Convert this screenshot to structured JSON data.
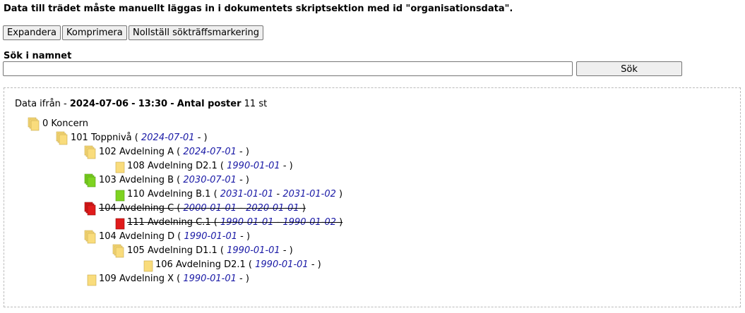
{
  "notice": "Data till trädet måste manuellt läggas in i dokumentets skriptsektion med id \"organisationsdata\".",
  "toolbar": {
    "expand_label": "Expandera",
    "collapse_label": "Komprimera",
    "reset_label": "Nollställ sökträffsmarkering"
  },
  "search": {
    "label": "Sök i namnet",
    "value": "",
    "button_label": "Sök"
  },
  "meta": {
    "prefix": "Data ifrån -",
    "date": "2024-07-06",
    "sep1": "-",
    "time": "13:30",
    "sep2": "-",
    "count_label": "Antal poster",
    "count": "11 st"
  },
  "colors": {
    "folder_yellow": "#f9dc7c",
    "folder_green": "#7ed321",
    "folder_red": "#e01b1b",
    "date_blue": "#1a1aa6"
  },
  "tree": [
    {
      "name": "0 Koncern",
      "from": "",
      "to": "",
      "icon": "folder-multi-icon",
      "color": "yellow",
      "depth": 0,
      "struck": false
    },
    {
      "name": "101 Toppnivå",
      "from": "2024-07-01",
      "to": "",
      "icon": "folder-multi-icon",
      "color": "yellow",
      "depth": 1,
      "struck": false
    },
    {
      "name": "102 Avdelning A",
      "from": "2024-07-01",
      "to": "",
      "icon": "folder-multi-icon",
      "color": "yellow",
      "depth": 2,
      "struck": false
    },
    {
      "name": "108 Avdelning D2.1",
      "from": "1990-01-01",
      "to": "",
      "icon": "folder-single-icon",
      "color": "yellow",
      "depth": 3,
      "struck": false
    },
    {
      "name": "103 Avdelning B",
      "from": "2030-07-01",
      "to": "",
      "icon": "folder-multi-icon",
      "color": "green",
      "depth": 2,
      "struck": false
    },
    {
      "name": "110 Avdelning B.1",
      "from": "2031-01-01",
      "to": "2031-01-02",
      "icon": "folder-single-icon",
      "color": "green",
      "depth": 3,
      "struck": false
    },
    {
      "name": "104 Avdelning C",
      "from": "2000-01-01",
      "to": "2020-01-01",
      "icon": "folder-multi-icon",
      "color": "red",
      "depth": 2,
      "struck": true
    },
    {
      "name": "111 Avdelning C.1",
      "from": "1990-01-01",
      "to": "1990-01-02",
      "icon": "folder-single-icon",
      "color": "red",
      "depth": 3,
      "struck": true
    },
    {
      "name": "104 Avdelning D",
      "from": "1990-01-01",
      "to": "",
      "icon": "folder-multi-icon",
      "color": "yellow",
      "depth": 2,
      "struck": false
    },
    {
      "name": "105 Avdelning D1.1",
      "from": "1990-01-01",
      "to": "",
      "icon": "folder-multi-icon",
      "color": "yellow",
      "depth": 3,
      "struck": false
    },
    {
      "name": "106 Avdelning D2.1",
      "from": "1990-01-01",
      "to": "",
      "icon": "folder-single-icon",
      "color": "yellow",
      "depth": 4,
      "struck": false
    },
    {
      "name": "109 Avdelning X",
      "from": "1990-01-01",
      "to": "",
      "icon": "folder-single-icon",
      "color": "yellow",
      "depth": 2,
      "struck": false
    }
  ]
}
